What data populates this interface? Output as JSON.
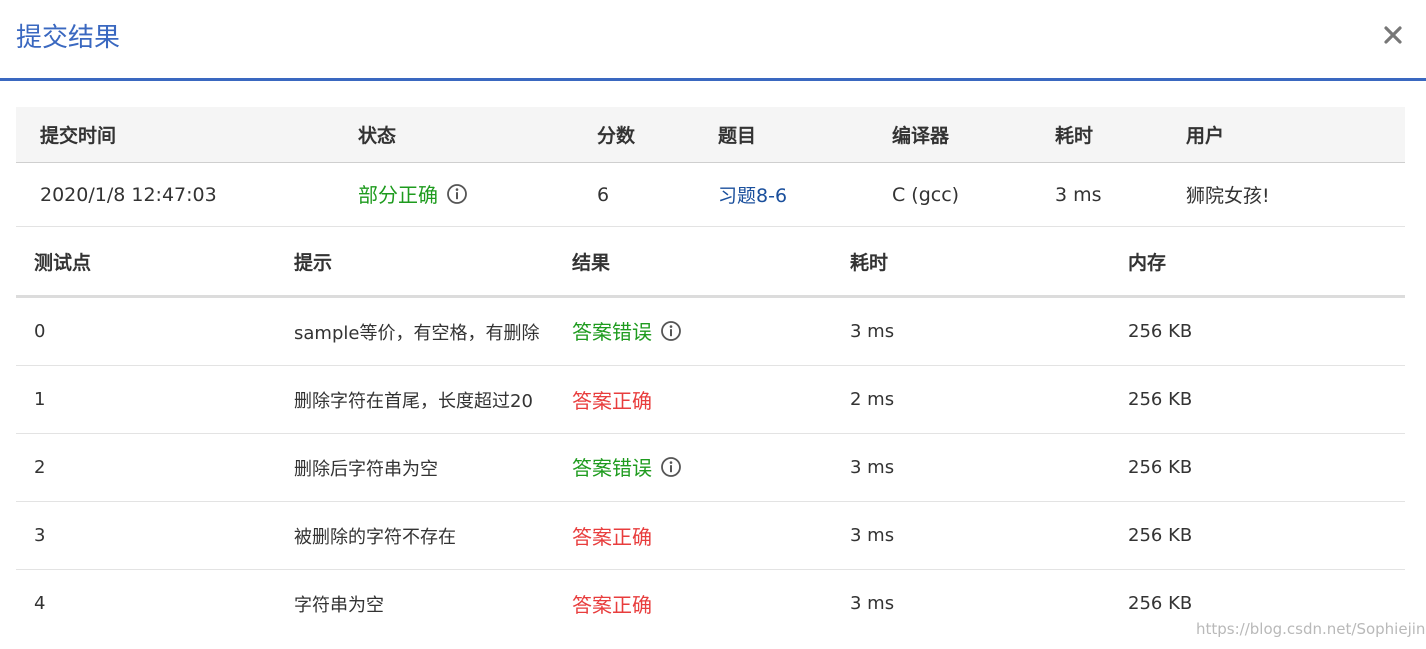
{
  "dialog": {
    "title": "提交结果",
    "close_icon": "close-icon"
  },
  "summary": {
    "headers": [
      "提交时间",
      "状态",
      "分数",
      "题目",
      "编译器",
      "耗时",
      "用户"
    ],
    "row": {
      "submit_time": "2020/1/8 12:47:03",
      "status": "部分正确",
      "score": "6",
      "problem": "习题8-6",
      "compiler": "C (gcc)",
      "time": "3 ms",
      "user": "狮院女孩!"
    }
  },
  "tests": {
    "headers": [
      "测试点",
      "提示",
      "结果",
      "耗时",
      "内存"
    ],
    "rows": [
      {
        "id": "0",
        "hint": "sample等价，有空格，有删除",
        "result": "答案错误",
        "time": "3 ms",
        "memory": "256 KB"
      },
      {
        "id": "1",
        "hint": "删除字符在首尾，长度超过20",
        "result": "答案正确",
        "time": "2 ms",
        "memory": "256 KB"
      },
      {
        "id": "2",
        "hint": "删除后字符串为空",
        "result": "答案错误",
        "time": "3 ms",
        "memory": "256 KB"
      },
      {
        "id": "3",
        "hint": "被删除的字符不存在",
        "result": "答案正确",
        "time": "3 ms",
        "memory": "256 KB"
      },
      {
        "id": "4",
        "hint": "字符串为空",
        "result": "答案正确",
        "time": "3 ms",
        "memory": "256 KB"
      }
    ]
  },
  "colors": {
    "accent": "#3a68c0",
    "success": "#1e9b1e",
    "error": "#e83d3d",
    "link": "#1a4f9c"
  },
  "watermark": "https://blog.csdn.net/Sophiejing"
}
